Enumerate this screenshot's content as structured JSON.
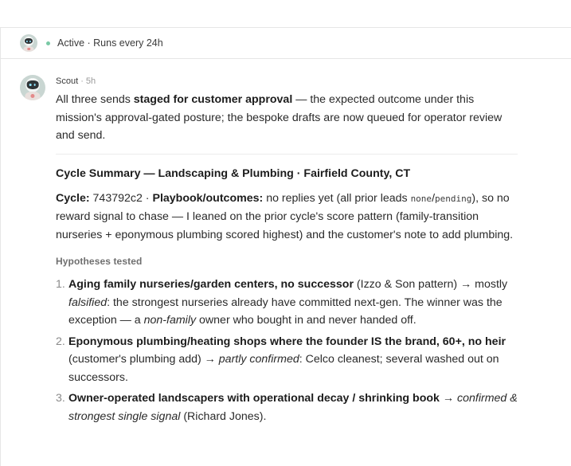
{
  "status": {
    "text": "Active · Runs every 24h",
    "dot_color": "#79c9a5"
  },
  "message": {
    "author": "Scout",
    "time": "· 5h",
    "lead": {
      "p1": "All three sends ",
      "b1": "staged for customer approval",
      "p2": " — the expected outcome under this mission's approval-gated posture; the bespoke drafts are now queued for operator review and send."
    },
    "summary_title": "Cycle Summary — Landscaping & Plumbing · Fairfield County, CT",
    "cycle": {
      "label": "Cycle:",
      "id": " 743792c2 · ",
      "outcomes_label": "Playbook/outcomes:",
      "p1": " no replies yet (all prior leads ",
      "code1": "none",
      "slash": "/",
      "code2": "pending",
      "p2": "), so no reward signal to chase — I leaned on the prior cycle's score pattern (family-transition nurseries + eponymous plumbing scored highest) and the customer's note to add plumbing."
    },
    "hypotheses_label": "Hypotheses tested",
    "hypotheses": [
      {
        "num": "1.",
        "bold": "Aging family nurseries/garden centers, no successor",
        "p1": " (Izzo & Son pattern) → mostly ",
        "em1": "falsified",
        "p2": ": the strongest nurseries already have committed next-gen. The winner was the exception — a ",
        "em2": "non-family",
        "p3": " owner who bought in and never handed off."
      },
      {
        "num": "2.",
        "bold": "Eponymous plumbing/heating shops where the founder IS the brand, 60+, no heir",
        "p1": " (customer's plumbing add) → ",
        "em1": "partly confirmed",
        "p2": ": Celco cleanest; several washed out on successors."
      },
      {
        "num": "3.",
        "bold": "Owner-operated landscapers with operational decay / shrinking book",
        "p1": " → ",
        "em1": "confirmed & strongest single signal",
        "p2": " (Richard Jones)."
      }
    ]
  },
  "icons": {
    "avatar": "robot-avatar-icon",
    "status": "status-dot-icon"
  }
}
